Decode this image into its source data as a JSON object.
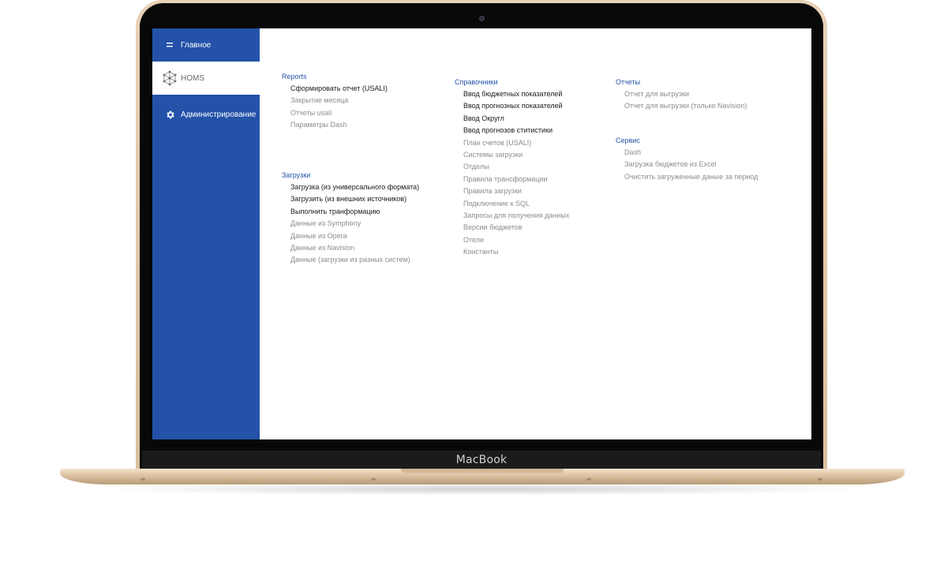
{
  "device": {
    "brand_label": "MacBook"
  },
  "sidebar": {
    "items": [
      {
        "label": "Главное",
        "icon": "menu-icon",
        "active": false
      },
      {
        "label": "HOMS",
        "icon": "logo-icon",
        "active": true
      },
      {
        "label": "Администрирование",
        "icon": "gear-icon",
        "active": false
      }
    ]
  },
  "colors": {
    "accent": "#2352a8",
    "link_dark": "#1a1a1a",
    "link_grey": "#8c8c8c"
  },
  "sections": {
    "reports": {
      "title": "Reports",
      "links": [
        {
          "label": "Сформировать отчет (USALI)",
          "style": "dark"
        },
        {
          "label": "Закрытие месяца",
          "style": "grey"
        },
        {
          "label": "Отчеты usali",
          "style": "grey"
        },
        {
          "label": "Параметры Dash",
          "style": "grey"
        }
      ]
    },
    "uploads": {
      "title": "Загрузки",
      "links": [
        {
          "label": "Загрузка (из универсального формата)",
          "style": "dark"
        },
        {
          "label": "Загрузить (из внешних источников)",
          "style": "dark"
        },
        {
          "label": "Выполнить транформацию",
          "style": "dark"
        },
        {
          "label": "Данные из Symphony",
          "style": "grey"
        },
        {
          "label": "Данные из Opera",
          "style": "grey"
        },
        {
          "label": "Данные из Navision",
          "style": "grey"
        },
        {
          "label": "Данные (загрузки из разных систем)",
          "style": "grey"
        }
      ]
    },
    "references": {
      "title": "Справочники",
      "links": [
        {
          "label": "Ввод бюджетных показателей",
          "style": "dark"
        },
        {
          "label": "Ввод прогнозных показателей",
          "style": "dark"
        },
        {
          "label": "Ввод Округл",
          "style": "dark"
        },
        {
          "label": "Ввод прогнозов ститистики",
          "style": "dark"
        },
        {
          "label": "План счетов (USALI)",
          "style": "grey"
        },
        {
          "label": "Системы загрузки",
          "style": "grey"
        },
        {
          "label": "Отделы",
          "style": "grey"
        },
        {
          "label": "Правила трансформации",
          "style": "grey"
        },
        {
          "label": "Правила загрузки",
          "style": "grey"
        },
        {
          "label": "Подключение к SQL",
          "style": "grey"
        },
        {
          "label": "Запросы для получения данных",
          "style": "grey"
        },
        {
          "label": "Версии бюджетов",
          "style": "grey"
        },
        {
          "label": "Отели",
          "style": "grey"
        },
        {
          "label": "Константы",
          "style": "grey"
        }
      ]
    },
    "exports": {
      "title": "Отчеты",
      "links": [
        {
          "label": "Отчет для выгрузки",
          "style": "grey"
        },
        {
          "label": "Отчет для выгрузки (только Navision)",
          "style": "grey"
        }
      ]
    },
    "service": {
      "title": "Сервис",
      "links": [
        {
          "label": "Dash",
          "style": "grey"
        },
        {
          "label": "Загрузка бюджетов из Excel",
          "style": "grey"
        },
        {
          "label": "Очистить загруженные даные за период",
          "style": "grey"
        }
      ]
    }
  }
}
